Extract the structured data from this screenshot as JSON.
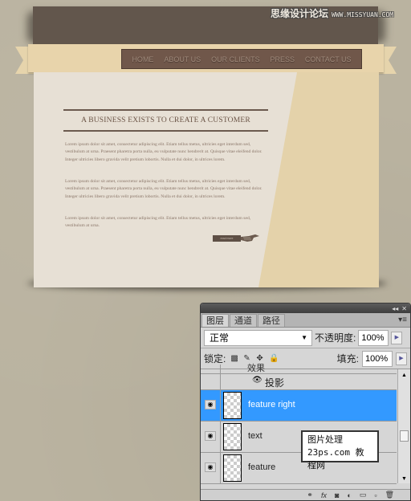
{
  "watermark": {
    "cn": "思缘设计论坛",
    "url": "WWW.MISSYUAN.COM"
  },
  "nav": {
    "items": [
      "HOME",
      "ABOUT US",
      "OUR CLIENTS",
      "PRESS",
      "CONTACT US"
    ]
  },
  "content": {
    "heading": "A BUSINESS EXISTS TO CREATE A CUSTOMER",
    "paragraphs": [
      "Lorem ipsum dolor sit amet, consectetur adipiscing elit. Etiam tellus metus, ultricies eget interdum sed, vestibulum at urna. Praesent pharetra porta nulla, eu vulputate nunc hendrerit at. Quisque vitae eleifend dolor. Integer ultricies libero gravida velit pretium lobortis. Nulla et dui dolor, in ultrices lorem.",
      "Lorem ipsum dolor sit amet, consectetur adipiscing elit. Etiam tellus metus, ultricies eget interdum sed, vestibulum at urna. Praesent pharetra porta nulla, eu vulputate nunc hendrerit at. Quisque vitae eleifend dolor. Integer ultricies libero gravida velit pretium lobortis. Nulla et dui dolor, in ultrices lorem.",
      "Lorem ipsum dolor sit amet, consectetur adipiscing elit. Etiam tellus metus, ultricies eget interdum sed, vestibulum at urna."
    ],
    "read_more": "read more"
  },
  "panel": {
    "tabs": [
      "图层",
      "通道",
      "路径"
    ],
    "blend_mode": "正常",
    "opacity_label": "不透明度:",
    "opacity": "100%",
    "lock_label": "锁定:",
    "fill_label": "填充:",
    "fill": "100%",
    "effects_label": "效果",
    "effect_item": "投影",
    "layers": [
      {
        "name": "feature right",
        "selected": true
      },
      {
        "name": "text",
        "selected": false
      },
      {
        "name": "feature",
        "selected": false
      }
    ],
    "watermark_line1": "图片处理",
    "watermark_line2": "23ps.com 教程网"
  }
}
